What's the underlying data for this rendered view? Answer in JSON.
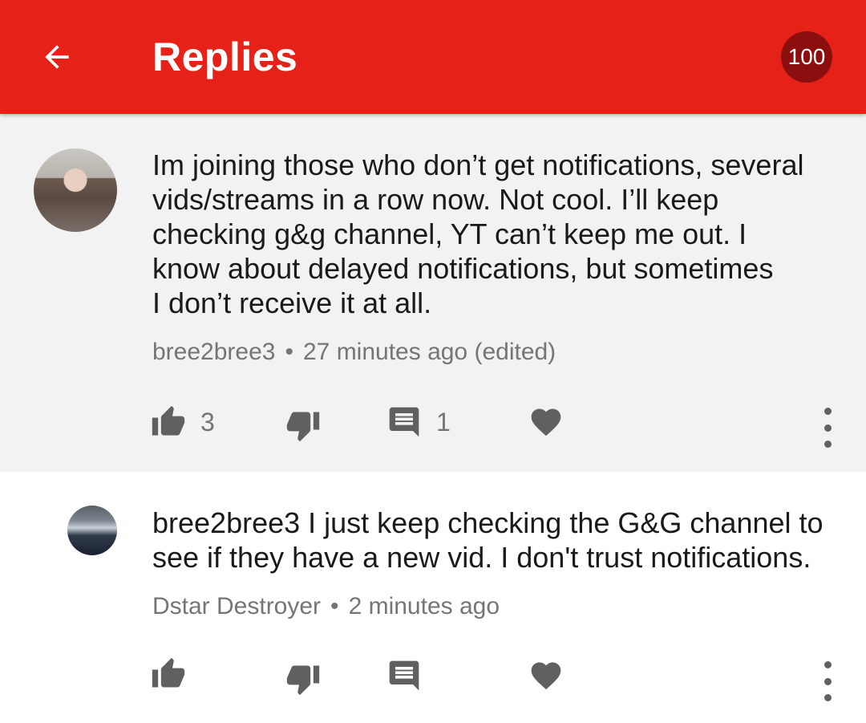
{
  "appbar": {
    "title": "Replies",
    "badge": "100",
    "back_icon": "arrow-back-icon",
    "color": "#e62117"
  },
  "parent_comment": {
    "text": "Im joining those who don’t get notifications, several\nvids/streams in a row now. Not cool. I’ll keep\nchecking g&g channel, YT can’t keep me out. I\nknow about delayed notifications, but sometimes\nI don’t receive it at all.",
    "author": "bree2bree3",
    "separator": "•",
    "time": "27 minutes ago (edited)",
    "like_count": "3",
    "reply_count": "1"
  },
  "reply_comment": {
    "text": "bree2bree3 I just keep checking the G&G channel to\nsee if they have a new vid. I don't trust notifications.",
    "author": "Dstar Destroyer",
    "separator": "•",
    "time": "2 minutes ago"
  },
  "icons": {
    "like": "thumb-up-icon",
    "dislike": "thumb-down-icon",
    "reply": "comment-icon",
    "heart": "heart-icon",
    "more": "more-vertical-icon"
  }
}
